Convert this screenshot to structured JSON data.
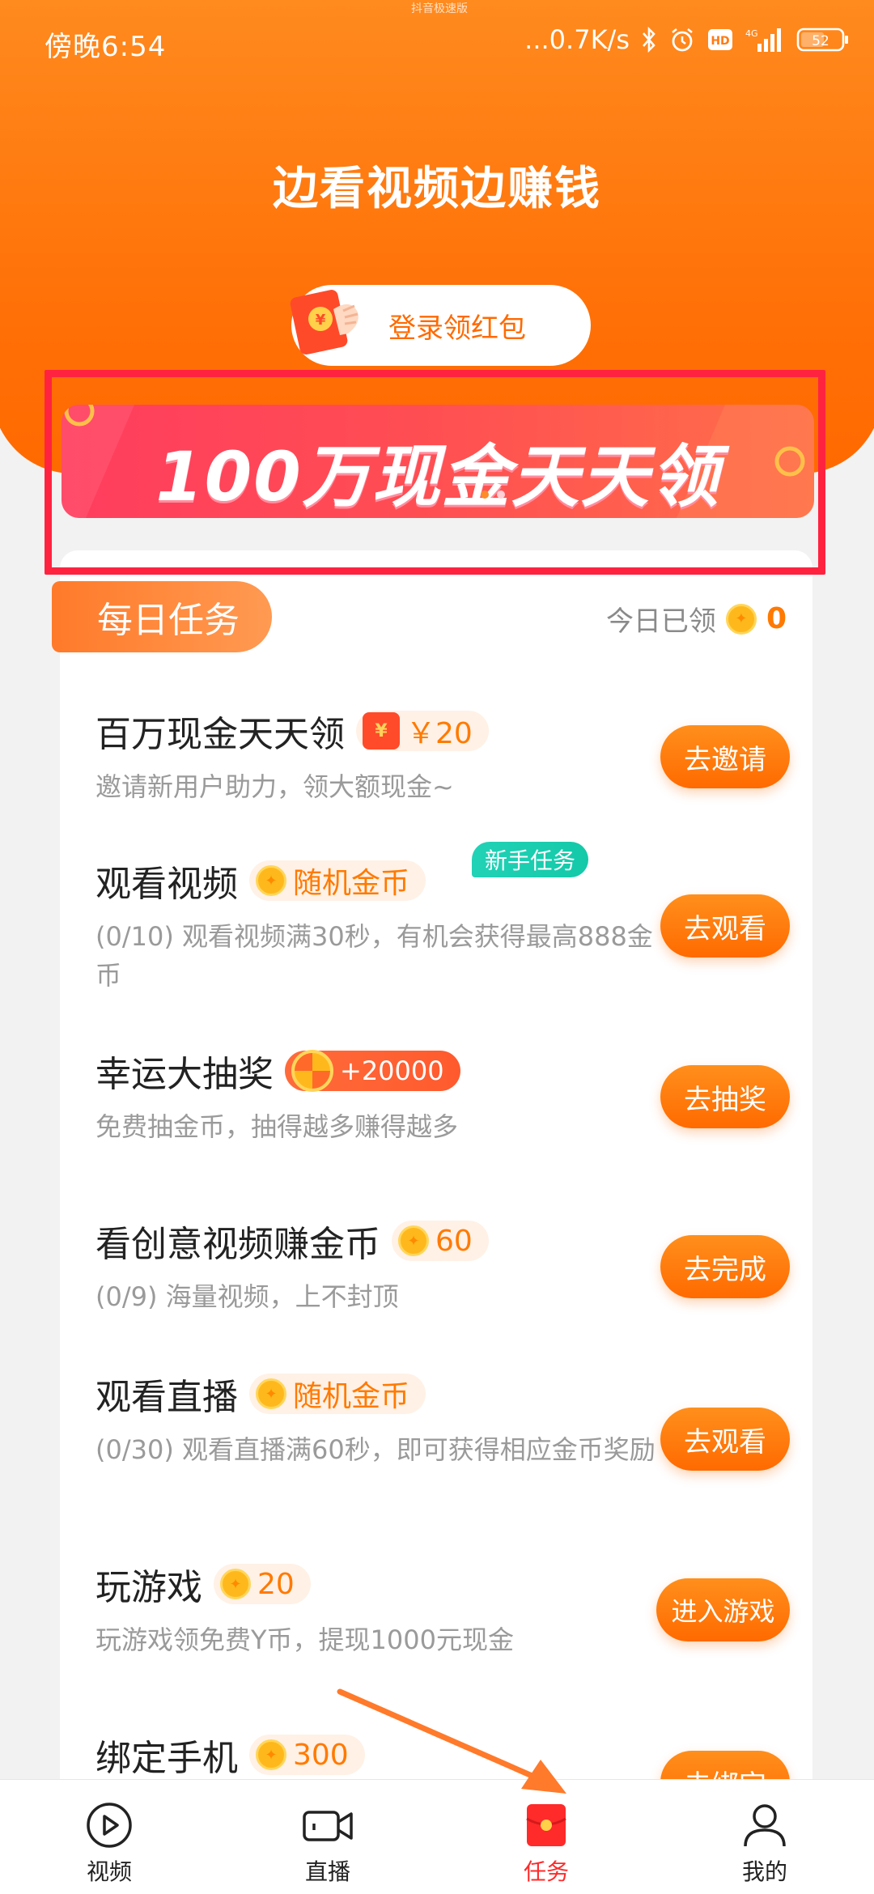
{
  "status_bar": {
    "time": "傍晚6:54",
    "center_text": "抖音极速版",
    "network_speed": "...0.7K/s",
    "battery": "52",
    "signal_label": "4G"
  },
  "header": {
    "title": "边看视频边赚钱",
    "login_button": "登录领红包"
  },
  "banner": {
    "text": "100万现金天天领"
  },
  "daily": {
    "section_title": "每日任务",
    "today_label": "今日已领",
    "today_count": "0"
  },
  "tasks": [
    {
      "title": "百万现金天天领",
      "reward": "￥20",
      "desc": "邀请新用户助力，领大额现金~",
      "button": "去邀请"
    },
    {
      "title": "观看视频",
      "reward": "随机金币",
      "badge": "新手任务",
      "desc": "(0/10) 观看视频满30秒，有机会获得最高888金币",
      "button": "去观看"
    },
    {
      "title": "幸运大抽奖",
      "reward": "+20000",
      "desc": "免费抽金币，抽得越多赚得越多",
      "button": "去抽奖"
    },
    {
      "title": "看创意视频赚金币",
      "reward": "60",
      "desc": "(0/9) 海量视频，上不封顶",
      "button": "去完成"
    },
    {
      "title": "观看直播",
      "reward": "随机金币",
      "desc": "(0/30) 观看直播满60秒，即可获得相应金币奖励",
      "button": "去观看"
    },
    {
      "title": "玩游戏",
      "reward": "20",
      "desc": "玩游戏领免费Y币，提现1000元现金",
      "button": "进入游戏"
    },
    {
      "title": "绑定手机",
      "reward": "300",
      "desc": "",
      "button": "去绑定"
    }
  ],
  "nav": {
    "items": [
      {
        "label": "视频",
        "icon": "play-circle-icon"
      },
      {
        "label": "直播",
        "icon": "video-camera-icon"
      },
      {
        "label": "任务",
        "icon": "red-envelope-icon"
      },
      {
        "label": "我的",
        "icon": "person-icon"
      }
    ],
    "active_index": 2
  },
  "colors": {
    "accent": "#ff6a00",
    "header_orange": "#ff7a12",
    "banner_red": "#ff4b55",
    "highlight_frame": "#ff2340",
    "badge_teal": "#1ccaaa",
    "nav_active": "#ff2a2a"
  }
}
